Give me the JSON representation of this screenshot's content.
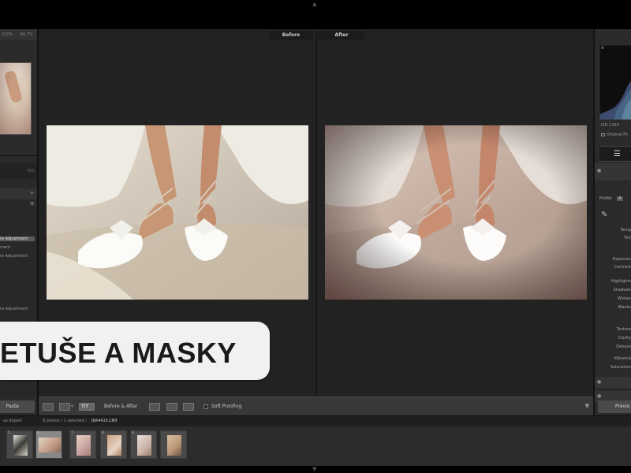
{
  "navigator": {
    "zoom_options": [
      "100%",
      "66.7%"
    ]
  },
  "left_panel": {
    "copy_row_label": "NIG",
    "history_items": [
      {
        "label": "re Adjustment",
        "selected": true
      },
      {
        "label": "ment",
        "selected": false
      },
      {
        "label": "re Adjustment",
        "selected": false
      },
      {
        "label": "re Adjustment",
        "selected": false
      },
      {
        "label": "ment",
        "selected": false
      },
      {
        "label": "re Adjustment",
        "selected": false
      },
      {
        "label": "re Adjustment",
        "selected": false
      }
    ],
    "paste_label": "Paste"
  },
  "compare": {
    "before_label": "Before",
    "after_label": "After"
  },
  "toolbar": {
    "view_label": "Y|Y",
    "mode_label": "Before & After",
    "soft_proofing_label": "Soft Proofing"
  },
  "right_panel": {
    "histogram_meta": "ISO 1250",
    "original_photo_label": "Original Ph",
    "profile_label": "Profile",
    "profile_tab": "A",
    "temp_label": "Temp",
    "tint_label": "Tint",
    "tone_labels": [
      "Exposure",
      "Contrast",
      "Highlights",
      "Shadows",
      "Whites",
      "Blacks"
    ],
    "presence_labels": [
      "Texture",
      "Clarity",
      "Dehaze",
      "Vibrance",
      "Saturation"
    ],
    "previous_label": "Previo"
  },
  "filmstrip": {
    "source_label": "us Import",
    "selection_info": "9 photos / 1 selected / ",
    "file_name": "J6A4415.CR3",
    "thumbnails": [
      {
        "number": "5",
        "selected": false
      },
      {
        "number": "6",
        "selected": true
      },
      {
        "number": "7",
        "selected": false
      },
      {
        "number": "8",
        "selected": false
      },
      {
        "number": "9",
        "selected": false
      },
      {
        "number": "",
        "selected": false
      }
    ]
  },
  "overlay": {
    "title": "ETUŠE A MASKY"
  },
  "colors": {
    "panel": "#2a2a2a",
    "workspace": "#222222",
    "banner_bg": "#f1f1f1",
    "banner_text": "#1a1a1a"
  }
}
